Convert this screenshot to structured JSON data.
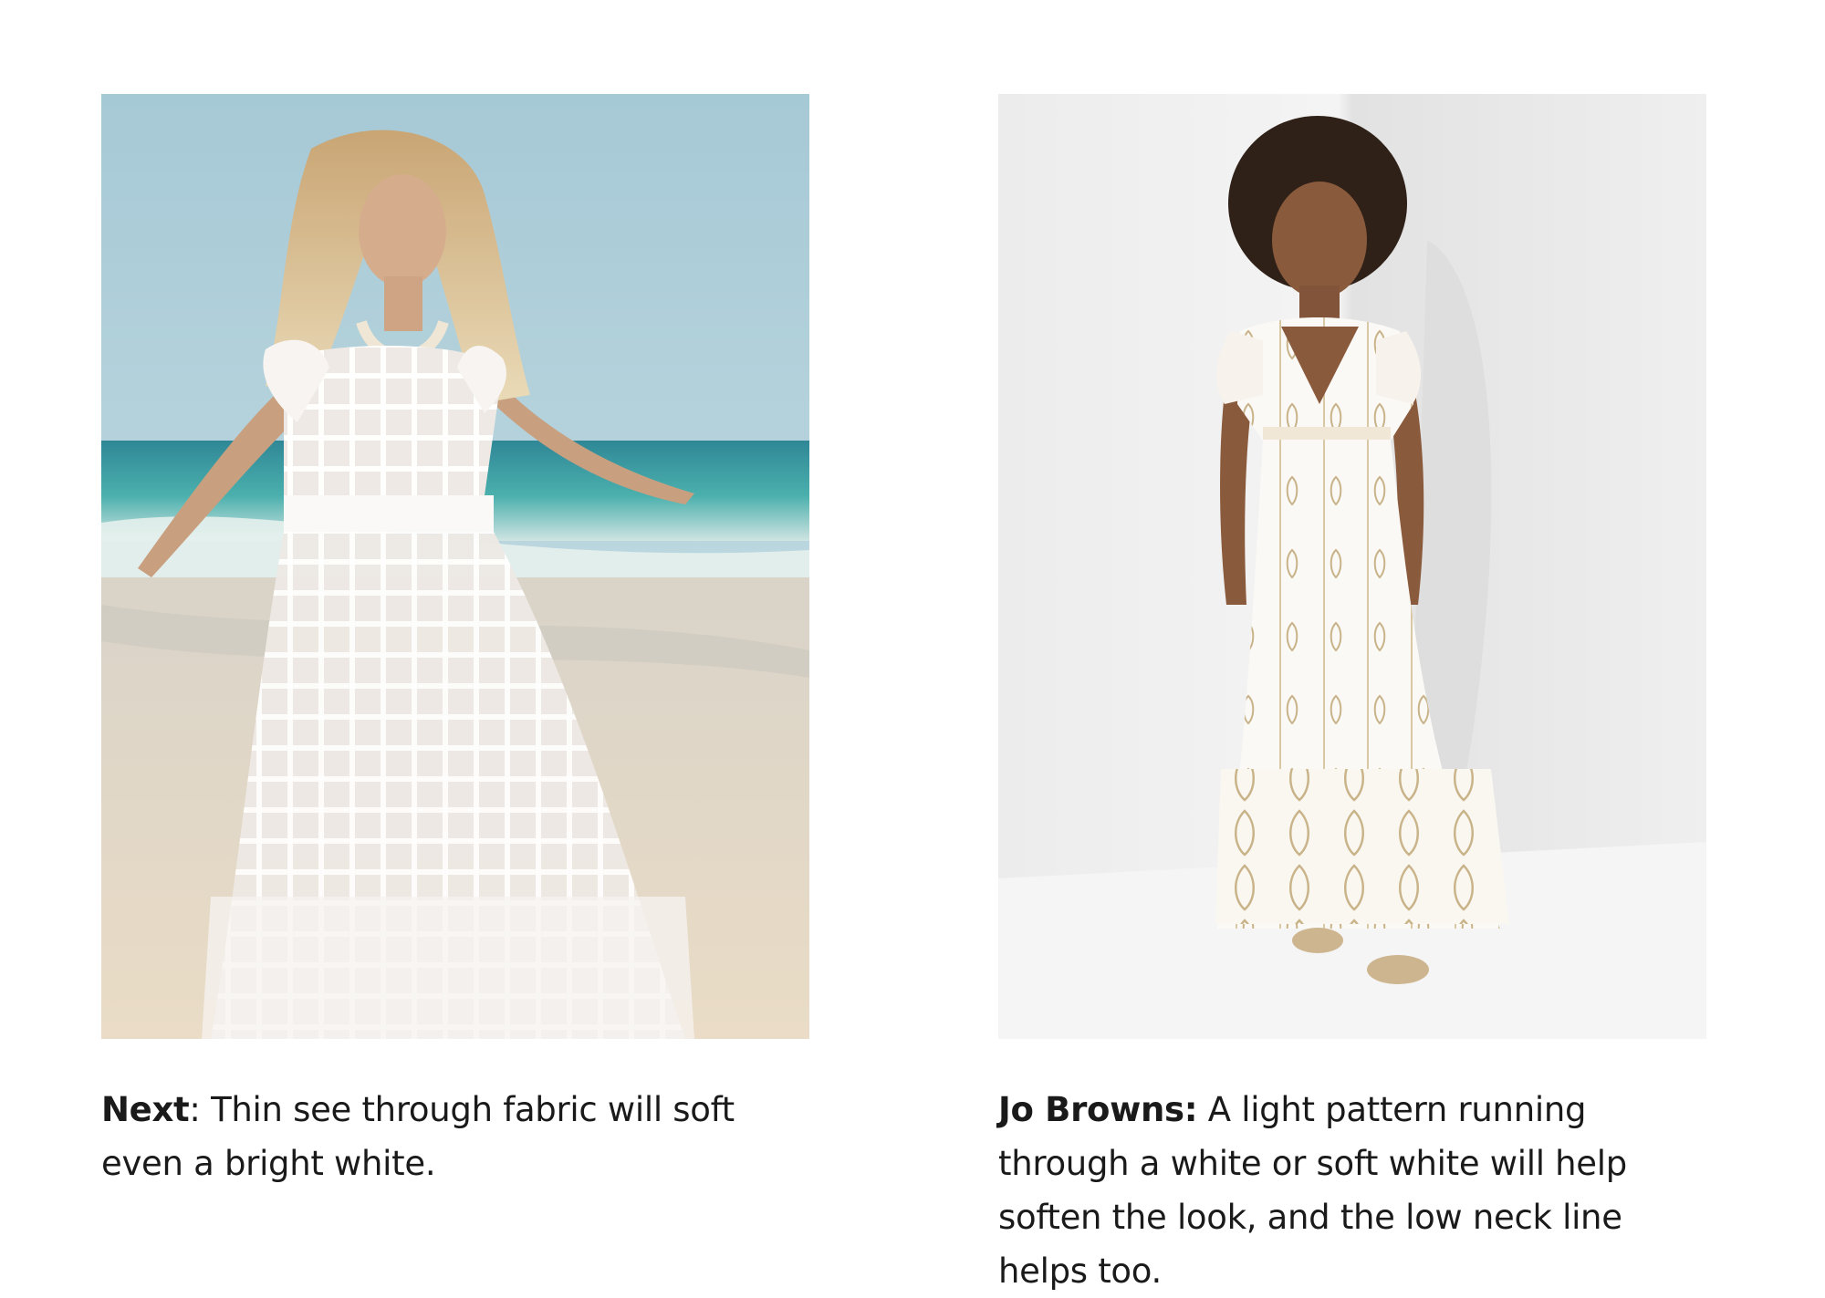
{
  "items": [
    {
      "brand": "Next",
      "separator": ": ",
      "text": "Thin see through fabric will soft even a bright white.",
      "image_description": "Woman in a sheer white gingham-check ruffled top and skirt walking on a beach"
    },
    {
      "brand": "Jo Browns:",
      "separator": " ",
      "text": "A light pattern running through a white or soft white will help soften the look, and the low neck line helps too.",
      "image_description": "Woman in a white maxi dress with gold paisley print and V-neck standing in a white corner"
    }
  ],
  "colors": {
    "text": "#1a1a1a",
    "background": "#ffffff",
    "sky": "#a9cdd8",
    "sea": "#3d9aa6",
    "sand": "#e8dcc8",
    "studio": "#eeeeee",
    "gold_print": "#c9b48a"
  }
}
